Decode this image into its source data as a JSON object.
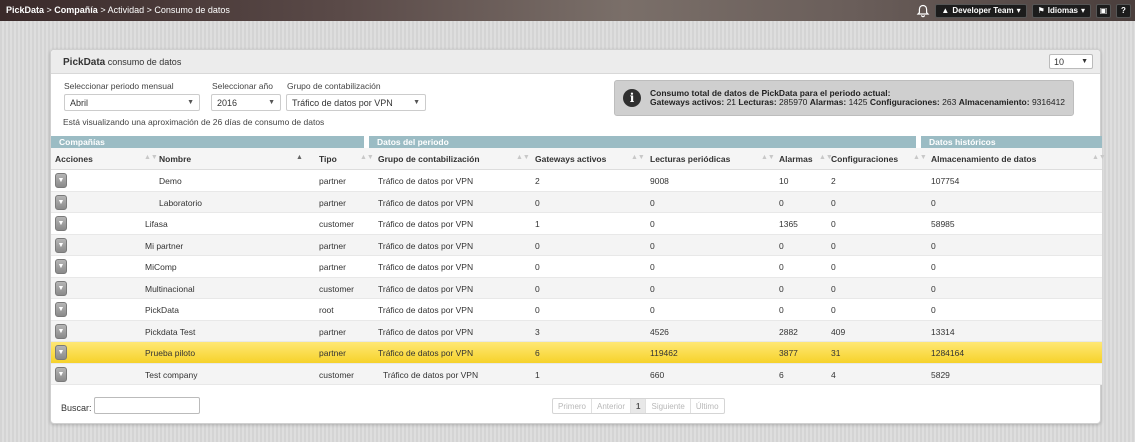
{
  "navbar": {
    "breadcrumb": [
      "PickData",
      "Compañía",
      "Actividad",
      "Consumo de datos"
    ],
    "user_button": "Developer Team",
    "language_button": "Idiomas",
    "help_button": "?"
  },
  "panel": {
    "title_bold": "PickData",
    "title_rest": "consumo de datos",
    "page_size": "10"
  },
  "filters": {
    "month_label": "Seleccionar periodo mensual",
    "month_value": "Abril",
    "year_label": "Seleccionar año",
    "year_value": "2016",
    "group_label": "Grupo de contabilización",
    "group_value": "Tráfico de datos por VPN",
    "note": "Está visualizando una aproximación de 26 días de consumo de datos"
  },
  "info": {
    "line1": "Consumo total de datos de PickData para el periodo actual:",
    "gateways_label": "Gateways activos:",
    "gateways_value": "21",
    "readings_label": "Lecturas:",
    "readings_value": "285970",
    "alarms_label": "Alarmas:",
    "alarms_value": "1425",
    "config_label": "Configuraciones:",
    "config_value": "263",
    "storage_label": "Almacenamiento:",
    "storage_value": "9316412"
  },
  "groups": {
    "companies": "Compañías",
    "period": "Datos del periodo",
    "historic": "Datos históricos"
  },
  "columns": {
    "actions": "Acciones",
    "name": "Nombre",
    "type": "Tipo",
    "group": "Grupo de contabilización",
    "gateways": "Gateways activos",
    "readings": "Lecturas periódicas",
    "alarms": "Alarmas",
    "configs": "Configuraciones",
    "storage": "Almacenamiento de datos"
  },
  "rows": [
    {
      "name": "Demo",
      "indent": true,
      "type": "partner",
      "group": "Tráfico de datos por VPN",
      "gateways": "2",
      "readings": "9008",
      "alarms": "10",
      "configs": "2",
      "storage": "107754"
    },
    {
      "name": "Laboratorio",
      "indent": true,
      "type": "partner",
      "group": "Tráfico de datos por VPN",
      "gateways": "0",
      "readings": "0",
      "alarms": "0",
      "configs": "0",
      "storage": "0"
    },
    {
      "name": "Lifasa",
      "indent": false,
      "type": "customer",
      "group": "Tráfico de datos por VPN",
      "gateways": "1",
      "readings": "0",
      "alarms": "1365",
      "configs": "0",
      "storage": "58985"
    },
    {
      "name": "Mi partner",
      "indent": false,
      "type": "partner",
      "group": "Tráfico de datos por VPN",
      "gateways": "0",
      "readings": "0",
      "alarms": "0",
      "configs": "0",
      "storage": "0"
    },
    {
      "name": "MiComp",
      "indent": false,
      "type": "partner",
      "group": "Tráfico de datos por VPN",
      "gateways": "0",
      "readings": "0",
      "alarms": "0",
      "configs": "0",
      "storage": "0"
    },
    {
      "name": "Multinacional",
      "indent": false,
      "type": "customer",
      "group": "Tráfico de datos por VPN",
      "gateways": "0",
      "readings": "0",
      "alarms": "0",
      "configs": "0",
      "storage": "0"
    },
    {
      "name": "PickData",
      "indent": false,
      "type": "root",
      "group": "Tráfico de datos por VPN",
      "gateways": "0",
      "readings": "0",
      "alarms": "0",
      "configs": "0",
      "storage": "0"
    },
    {
      "name": "Pickdata Test",
      "indent": false,
      "type": "partner",
      "group": "Tráfico de datos por VPN",
      "gateways": "3",
      "readings": "4526",
      "alarms": "2882",
      "configs": "409",
      "storage": "13314"
    },
    {
      "name": "Prueba piloto",
      "indent": false,
      "type": "partner",
      "group": "Tráfico de datos por VPN",
      "gateways": "6",
      "readings": "119462",
      "alarms": "3877",
      "configs": "31",
      "storage": "1284164",
      "highlight": true
    },
    {
      "name": "Test company",
      "indent": false,
      "type": "customer",
      "group": "Tráfico de datos por VPN",
      "gateways": "1",
      "readings": "660",
      "alarms": "6",
      "configs": "4",
      "storage": "5829"
    }
  ],
  "search": {
    "label": "Buscar:"
  },
  "pagination": [
    "Primero",
    "Anterior",
    "1",
    "Siguiente",
    "Último"
  ],
  "colors": {
    "group_header": "#9bbcc4",
    "highlight": "#f6d22a"
  }
}
